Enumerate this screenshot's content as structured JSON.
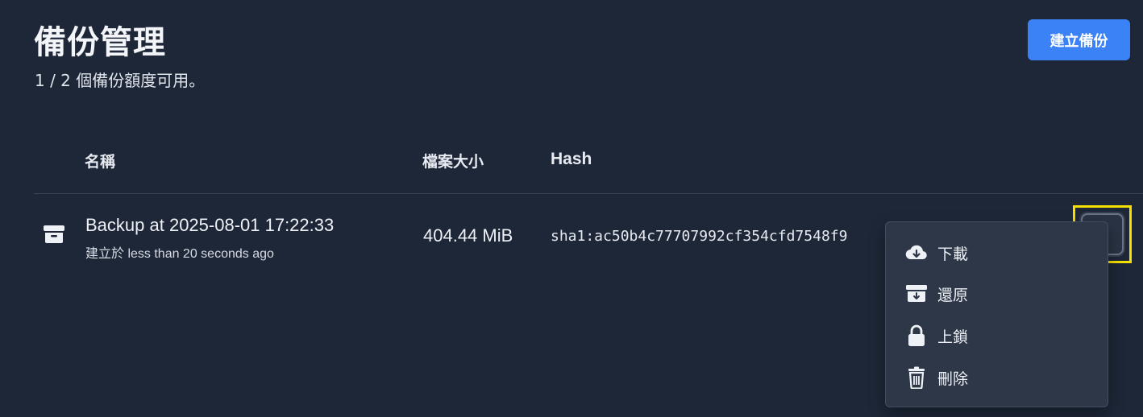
{
  "header": {
    "title": "備份管理",
    "subtitle": "1 / 2 個備份額度可用。",
    "create_button": "建立備份"
  },
  "table": {
    "columns": [
      "名稱",
      "檔案大小",
      "Hash"
    ],
    "rows": [
      {
        "name": "Backup at 2025-08-01 17:22:33",
        "created": "建立於 less than 20 seconds ago",
        "size": "404.44 MiB",
        "hash": "sha1:ac50b4c77707992cf354cfd7548f9"
      }
    ]
  },
  "menu": {
    "items": [
      {
        "label": "下載",
        "icon": "cloud-download-icon"
      },
      {
        "label": "還原",
        "icon": "archive-restore-icon"
      },
      {
        "label": "上鎖",
        "icon": "lock-icon"
      },
      {
        "label": "刪除",
        "icon": "trash-icon"
      }
    ]
  },
  "colors": {
    "background": "#1e2738",
    "accent": "#3b82f6",
    "highlight": "#f5e000",
    "menu_bg": "#2d3748"
  }
}
